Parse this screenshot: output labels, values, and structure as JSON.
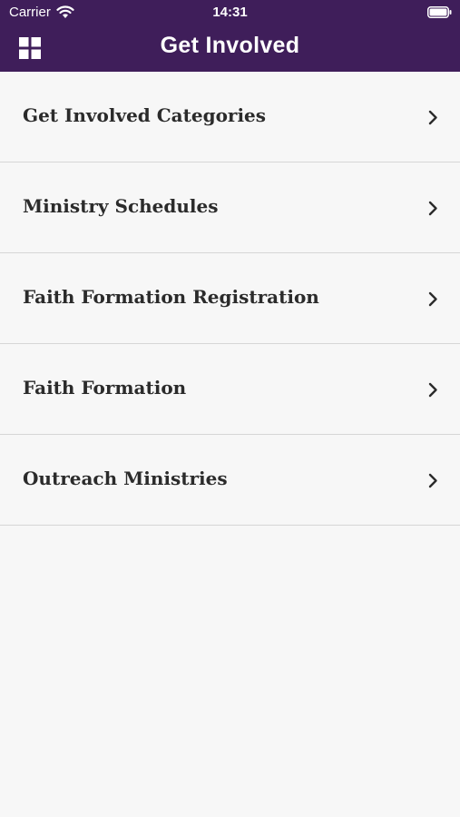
{
  "status_bar": {
    "carrier": "Carrier",
    "time": "14:31"
  },
  "header": {
    "title": "Get Involved",
    "background_color": "#3f1e5a",
    "menu_icon": "grid-icon"
  },
  "list": {
    "items": [
      {
        "label": "Get Involved Categories"
      },
      {
        "label": "Ministry Schedules"
      },
      {
        "label": "Faith Formation Registration"
      },
      {
        "label": "Faith Formation"
      },
      {
        "label": "Outreach Ministries"
      }
    ],
    "chevron_icon": "chevron-right-icon"
  }
}
